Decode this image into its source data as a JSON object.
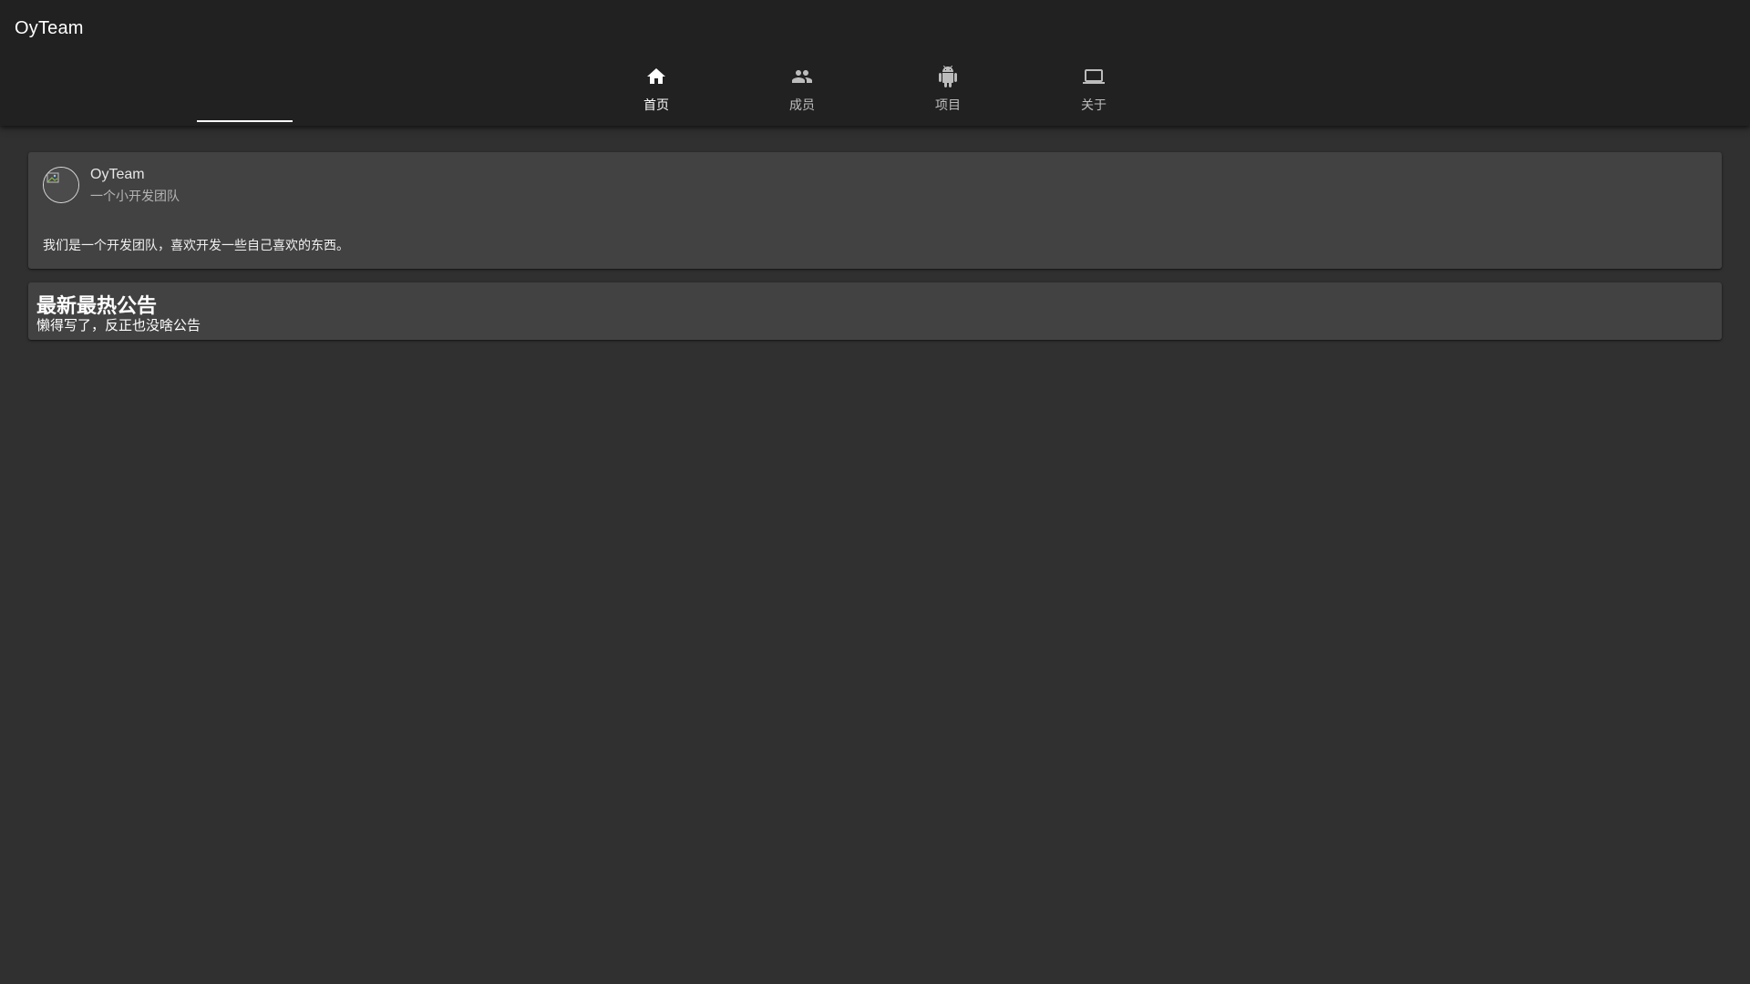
{
  "app": {
    "title": "OyTeam"
  },
  "tabs": [
    {
      "label": "首页",
      "icon": "home-icon",
      "active": true
    },
    {
      "label": "成员",
      "icon": "people-icon",
      "active": false
    },
    {
      "label": "项目",
      "icon": "android-icon",
      "active": false
    },
    {
      "label": "关于",
      "icon": "laptop-icon",
      "active": false
    }
  ],
  "intro_card": {
    "title": "OyTeam",
    "subtitle": "一个小开发团队",
    "text": "我们是一个开发团队，喜欢开发一些自己喜欢的东西。",
    "avatar_icon": "broken-image-avatar"
  },
  "notice_card": {
    "title": "最新最热公告",
    "text": "懒得写了，反正也没啥公告"
  },
  "colors": {
    "background": "#303030",
    "app_bar": "#212121",
    "card": "#424242",
    "indicator": "#ffffff"
  }
}
